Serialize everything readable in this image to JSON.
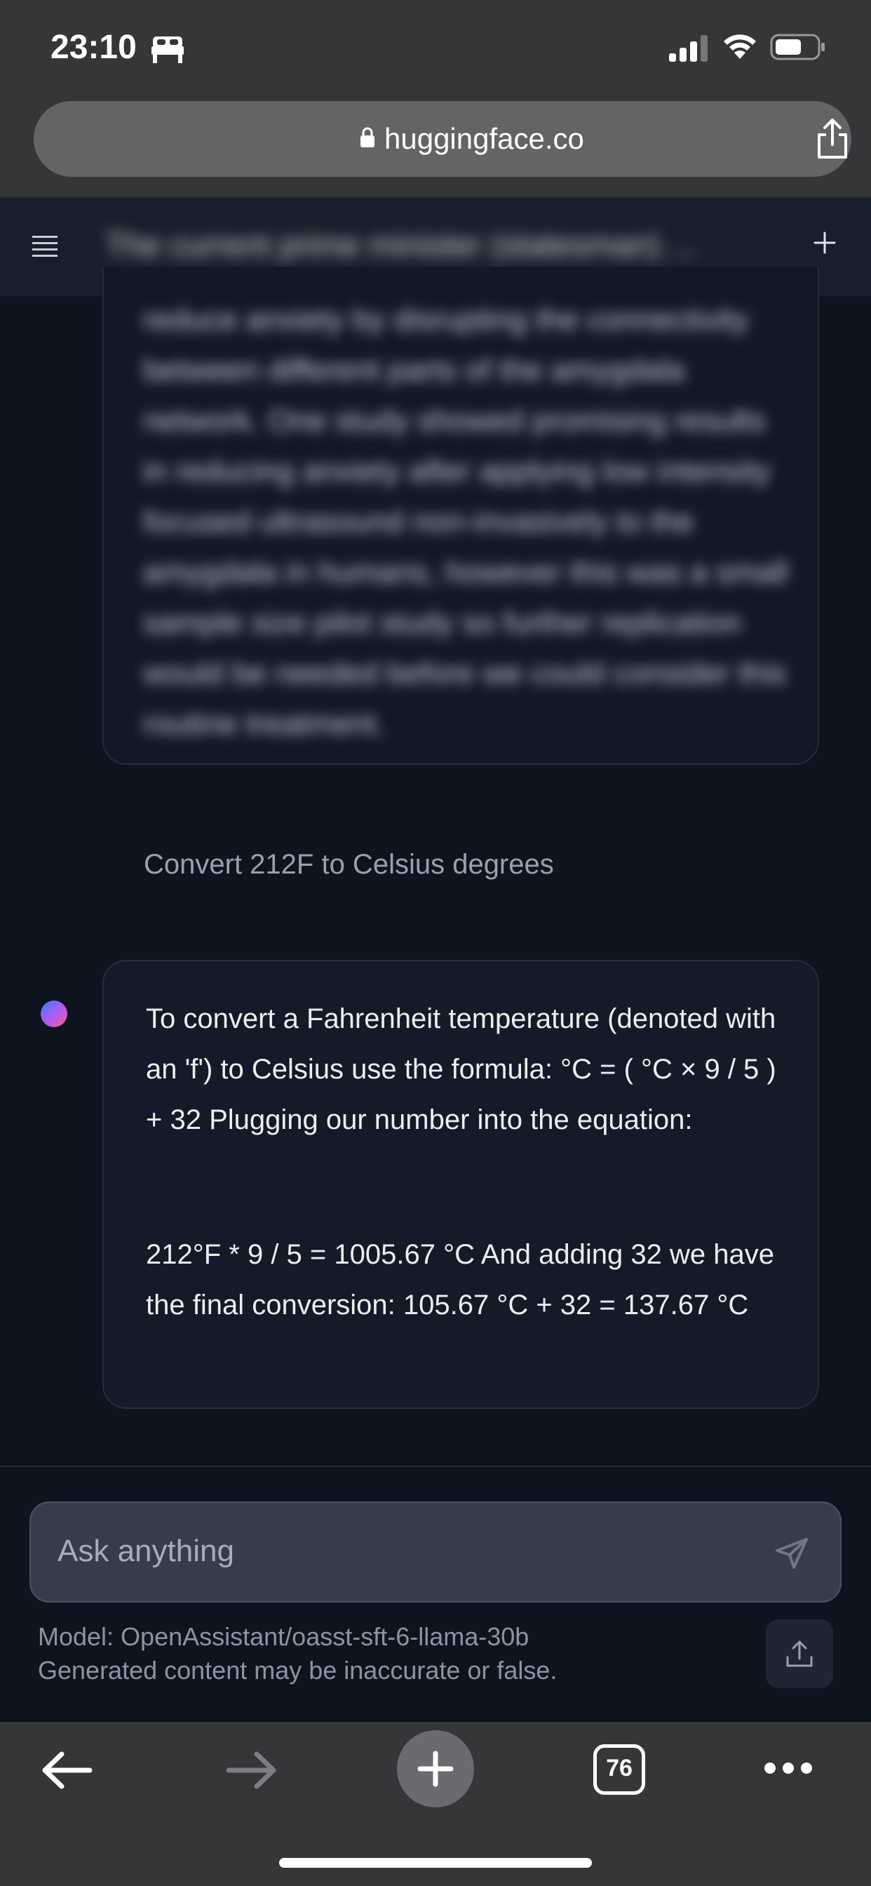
{
  "status_bar": {
    "time": "23:10",
    "icons": [
      "bed-icon",
      "cellular-signal-icon",
      "wifi-icon",
      "battery-icon"
    ]
  },
  "browser": {
    "url": "huggingface.co",
    "icons": [
      "lock-icon",
      "share-icon"
    ]
  },
  "chat_header": {
    "title": "The current prime minister (statesman) ...",
    "icons": [
      "menu-icon",
      "new-chat-plus-icon"
    ]
  },
  "previous_answer": {
    "text": "reduce anxiety by disrupting the connectivity between different parts of the amygdala network. One study showed promising results in reducing anxiety after applying low intensity focused ultrasound non-invasively to the amygdala in humans, however this was a small sample size pilot study so further replication would be needed before we could consider this routine treatment."
  },
  "messages": [
    {
      "role": "user",
      "text": "Convert 212F to Celsius degrees"
    },
    {
      "role": "assistant",
      "paragraphs": [
        "To convert a Fahrenheit temperature (denoted with an 'f') to Celsius use the formula: °C = ( °C × 9 / 5 ) + 32 Plugging our number into the equation:",
        "212°F * 9 / 5 = 1005.67 °C And adding 32 we have the final conversion: 105.67 °C + 32 = 137.67 °C"
      ]
    }
  ],
  "composer": {
    "placeholder": "Ask anything",
    "icons": [
      "send-icon",
      "upload-icon"
    ]
  },
  "footer": {
    "model_line": "Model: OpenAssistant/oasst-sft-6-llama-30b",
    "disclaimer": "Generated content may be inaccurate or false."
  },
  "browser_toolbar": {
    "tab_count": "76",
    "icons": [
      "back-arrow-icon",
      "forward-arrow-icon",
      "new-tab-plus-icon",
      "tabs-icon",
      "more-icon"
    ]
  },
  "colors": {
    "page_background": "#0e1320",
    "browser_chrome": "#353638",
    "card_background": "#141a28",
    "input_background": "#363c4b"
  }
}
